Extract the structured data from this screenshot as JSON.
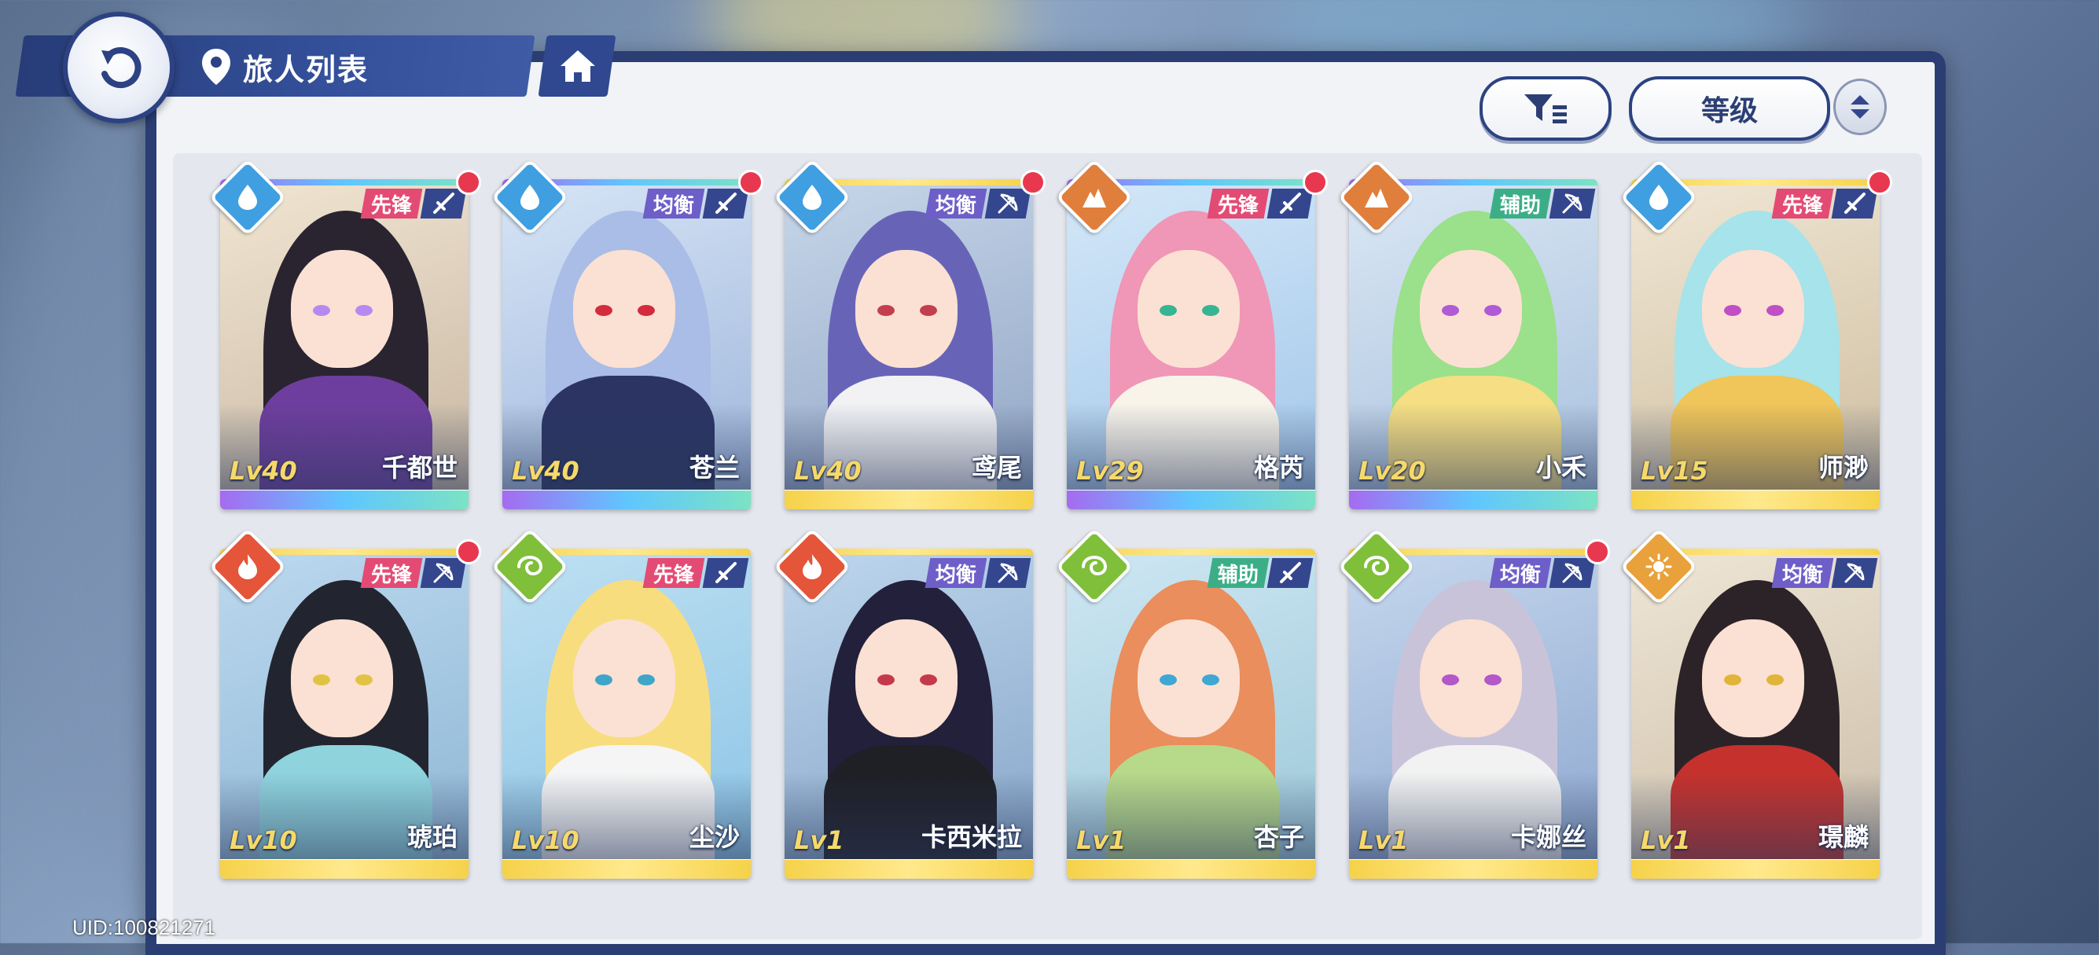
{
  "header": {
    "title": "旅人列表"
  },
  "controls": {
    "sort_label": "等级"
  },
  "footer": {
    "uid": "UID:100821271"
  },
  "colors": {
    "pioneer": "#e34b74",
    "balance": "#6d5ec8",
    "support": "#3cae87",
    "bar_rainbow": "linear-gradient(90deg,#a56bf0,#5fc6ff,#7be3c4)",
    "bar_gold": "linear-gradient(90deg,#f6d24a,#ffe98c,#f6d24a)"
  },
  "characters": [
    {
      "name": "千都世",
      "level": "Lv40",
      "role": "先锋",
      "element": "water-icon",
      "weapon": "sword-icon",
      "new": true,
      "bar": "rainbow",
      "hair": "#2a2431",
      "eye": "#b58af0",
      "sky": "linear-gradient(160deg,#f1e6d3,#c8b7a2)",
      "body": "#6e3e9e"
    },
    {
      "name": "苍兰",
      "level": "Lv40",
      "role": "均衡",
      "element": "water-icon",
      "weapon": "sword-icon",
      "new": true,
      "bar": "rainbow",
      "hair": "#a9bde6",
      "eye": "#d22c3e",
      "sky": "linear-gradient(160deg,#d7e5f6,#9fb7dc)",
      "body": "#2b3463"
    },
    {
      "name": "鸢尾",
      "level": "Lv40",
      "role": "均衡",
      "element": "water-icon",
      "weapon": "bow-icon",
      "new": true,
      "bar": "gold",
      "hair": "#6764b8",
      "eye": "#c33e4e",
      "sky": "linear-gradient(160deg,#c7d7ea,#92a6c5)",
      "body": "#f2f2f4"
    },
    {
      "name": "格芮",
      "level": "Lv29",
      "role": "先锋",
      "element": "rock-icon",
      "weapon": "sword-icon",
      "new": true,
      "bar": "rainbow",
      "hair": "#f096b6",
      "eye": "#36b595",
      "sky": "linear-gradient(160deg,#d4e8f8,#a3c7ea)",
      "body": "#f8f4ea"
    },
    {
      "name": "小禾",
      "level": "Lv20",
      "role": "辅助",
      "element": "rock-icon",
      "weapon": "bow-icon",
      "new": false,
      "bar": "rainbow",
      "hair": "#9be08a",
      "eye": "#b05ad6",
      "sky": "linear-gradient(160deg,#dbe7f4,#a9c2de)",
      "body": "#f5de83"
    },
    {
      "name": "师渺",
      "level": "Lv15",
      "role": "先锋",
      "element": "water-icon",
      "weapon": "sword-icon",
      "new": true,
      "bar": "gold",
      "hair": "#a6e3ea",
      "eye": "#c04fc5",
      "sky": "linear-gradient(160deg,#f0e7d5,#cfbfa1)",
      "body": "#f0c55a"
    },
    {
      "name": "琥珀",
      "level": "Lv10",
      "role": "先锋",
      "element": "fire-icon",
      "weapon": "bow-icon",
      "new": true,
      "bar": "gold",
      "hair": "#22252f",
      "eye": "#e1c344",
      "sky": "linear-gradient(160deg,#bcd9ef,#8fb7d5)",
      "body": "#8fd3dd"
    },
    {
      "name": "尘沙",
      "level": "Lv10",
      "role": "先锋",
      "element": "wind-icon",
      "weapon": "sword-icon",
      "new": false,
      "bar": "gold",
      "hair": "#f8dd7e",
      "eye": "#3fa5c9",
      "sky": "linear-gradient(160deg,#bfe0f2,#8cc5e6)",
      "body": "#f5f5f5"
    },
    {
      "name": "卡西米拉",
      "level": "Lv1",
      "role": "均衡",
      "element": "fire-icon",
      "weapon": "bow-icon",
      "new": false,
      "bar": "gold",
      "hair": "#23203b",
      "eye": "#c43a4c",
      "sky": "linear-gradient(160deg,#bfd7ee,#87a6c9)",
      "body": "#1f1f26"
    },
    {
      "name": "杏子",
      "level": "Lv1",
      "role": "辅助",
      "element": "wind-icon",
      "weapon": "sword-icon",
      "new": false,
      "bar": "gold",
      "hair": "#e98e5c",
      "eye": "#3fa7d4",
      "sky": "linear-gradient(160deg,#cfe7f3,#9dc9d9)",
      "body": "#b7d98a"
    },
    {
      "name": "卡娜丝",
      "level": "Lv1",
      "role": "均衡",
      "element": "wind-icon",
      "weapon": "bow-icon",
      "new": true,
      "bar": "gold",
      "hair": "#c9c3da",
      "eye": "#b357c9",
      "sky": "linear-gradient(160deg,#c6d8ee,#8ea8cf)",
      "body": "#f2f2f2"
    },
    {
      "name": "璟麟",
      "level": "Lv1",
      "role": "均衡",
      "element": "sun-icon",
      "weapon": "bow-icon",
      "new": false,
      "bar": "gold",
      "hair": "#2c2328",
      "eye": "#e1b43a",
      "sky": "linear-gradient(160deg,#efe6d6,#cdbfa9)",
      "body": "#c5322d"
    }
  ]
}
